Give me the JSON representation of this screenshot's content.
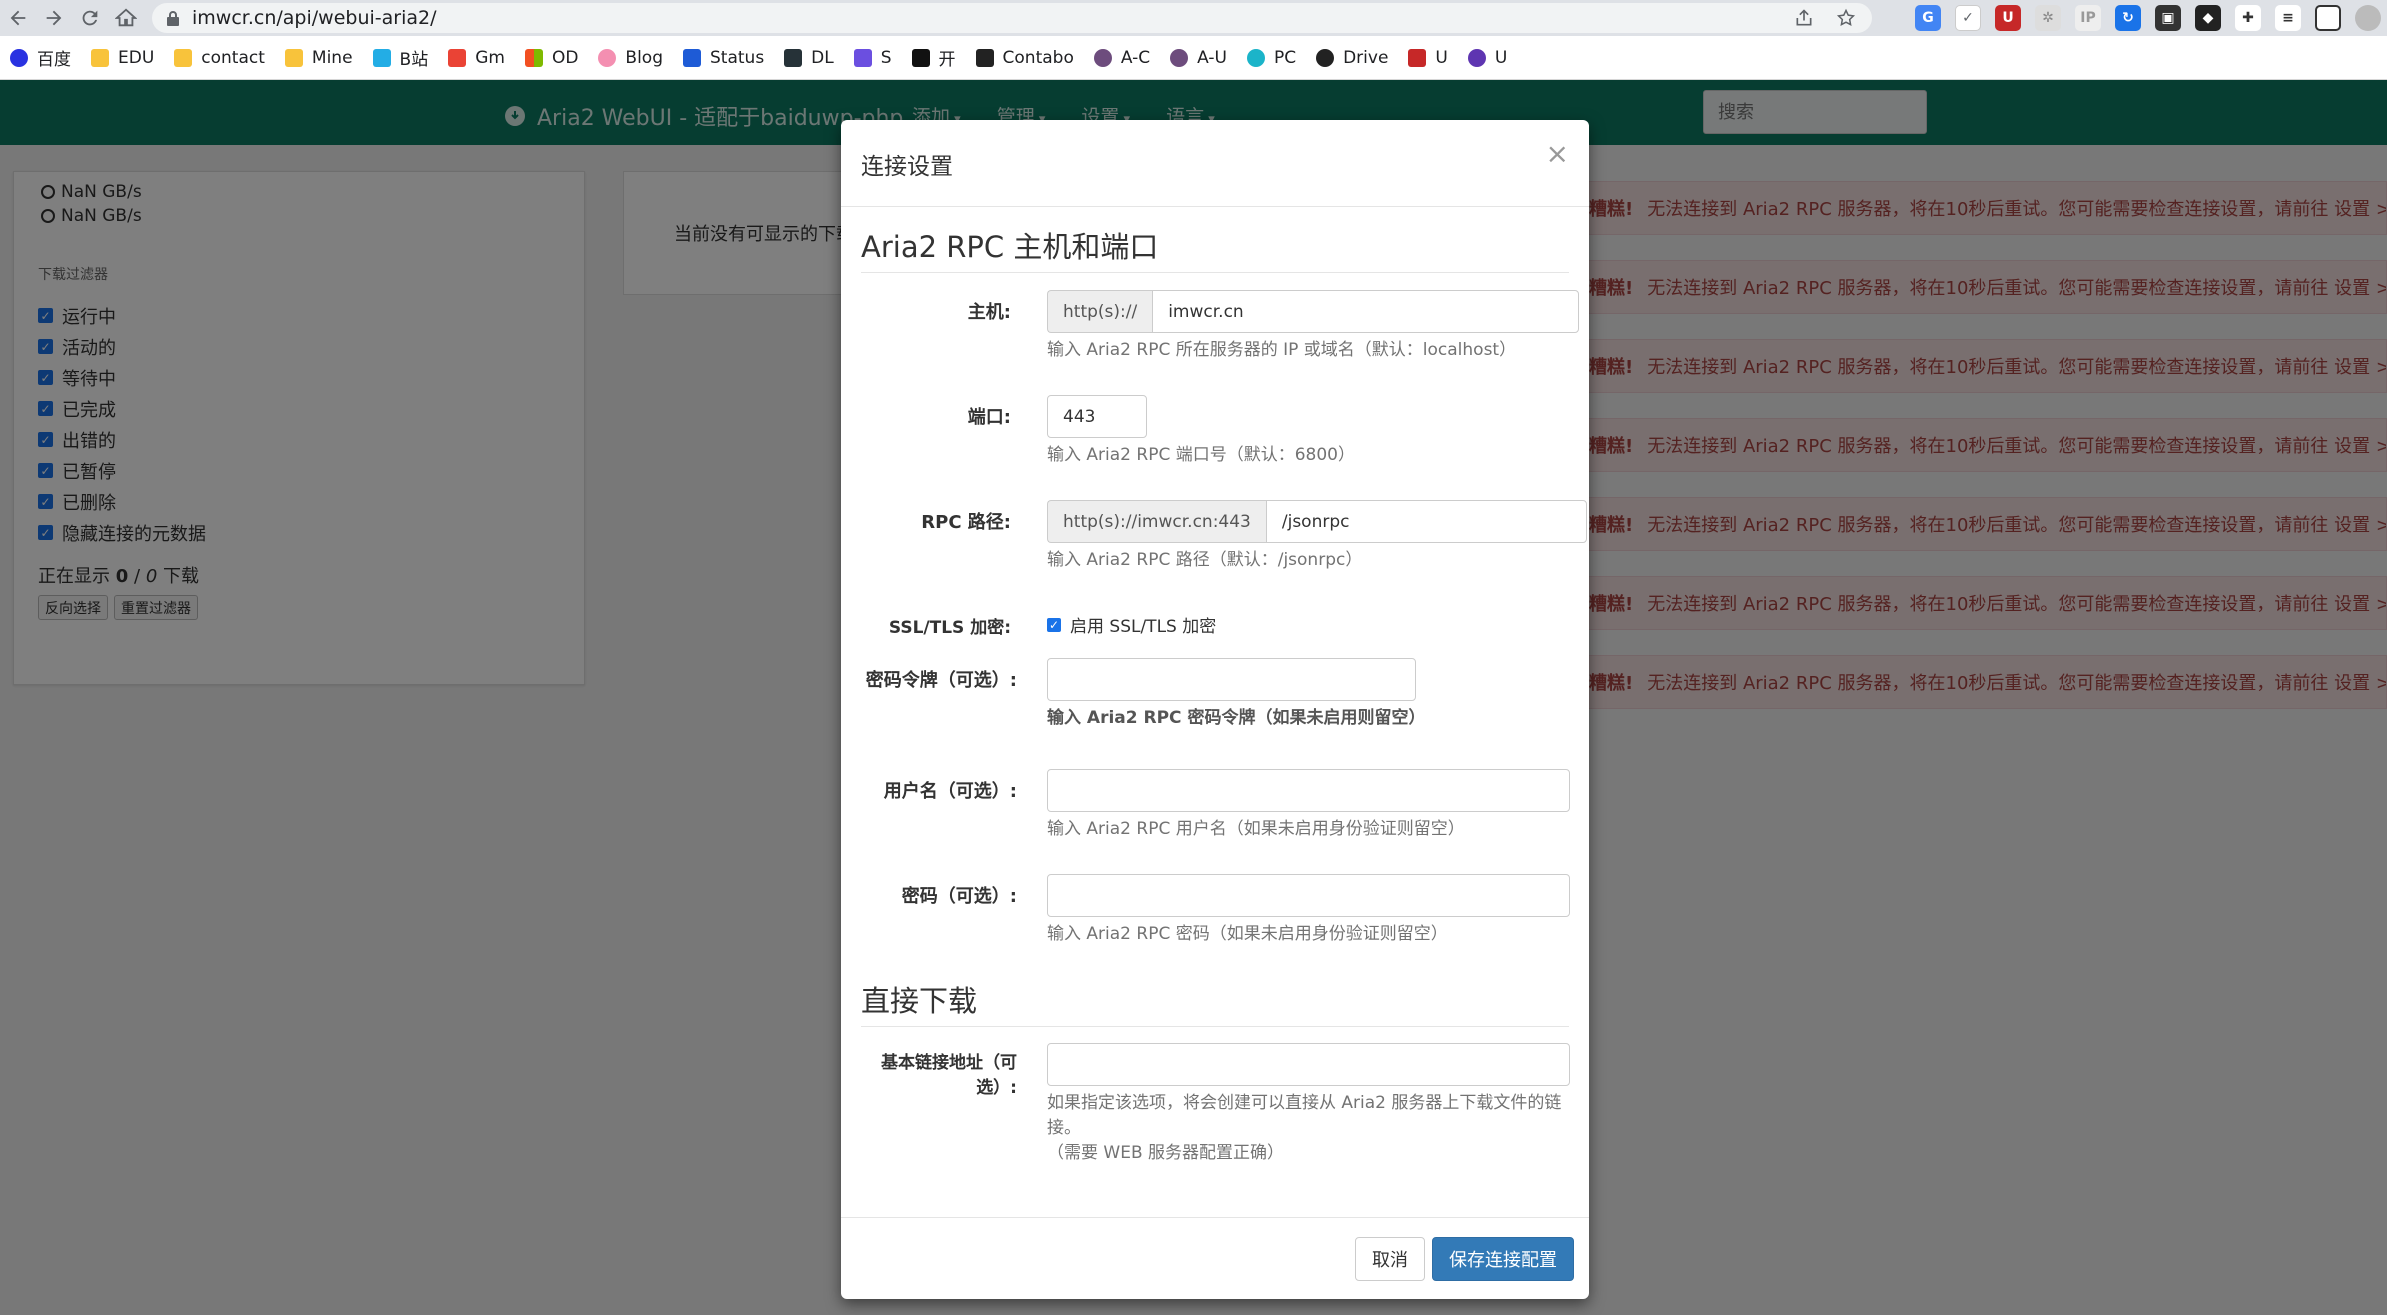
{
  "browser": {
    "url": "imwcr.cn/api/webui-aria2/",
    "bookmarks": [
      "百度",
      "EDU",
      "contact",
      "Mine",
      "B站",
      "Gm",
      "OD",
      "Blog",
      "Status",
      "DL",
      "S",
      "开",
      "Contabo",
      "A-C",
      "A-U",
      "PC",
      "Drive",
      "U",
      "U"
    ]
  },
  "navbar": {
    "brand": "Aria2 WebUI - 适配于baiduwp-php",
    "menus": [
      "添加",
      "管理",
      "设置",
      "语言"
    ],
    "search_placeholder": "搜索",
    "color": "#0d7a63"
  },
  "sidebar": {
    "download_speed": "NaN GB/s",
    "upload_speed": "NaN GB/s",
    "filter_title": "下载过滤器",
    "filters": [
      "运行中",
      "活动的",
      "等待中",
      "已完成",
      "出错的",
      "已暂停",
      "已删除",
      "隐藏连接的元数据"
    ],
    "showing_prefix": "正在显示",
    "showing_count": "0",
    "showing_sep": "/",
    "showing_total": "0",
    "showing_suffix": "下载",
    "btn_invert": "反向选择",
    "btn_reset": "重置过滤器"
  },
  "content": {
    "empty_text": "当前没有可显示的下载"
  },
  "alerts": {
    "title": "糟糕!",
    "message": "无法连接到 Aria2 RPC 服务器，将在10秒后重试。您可能需要检查连接设置，请前往 设置 > 连接设置",
    "count": 7
  },
  "modal": {
    "title": "连接设置",
    "close": "×",
    "section_rpc": "Aria2 RPC 主机和端口",
    "host_label": "主机:",
    "host_addon": "http(s)://",
    "host_value": "imwcr.cn",
    "host_help": "输入 Aria2 RPC 所在服务器的 IP 或域名（默认：localhost）",
    "port_label": "端口:",
    "port_value": "443",
    "port_help": "输入 Aria2 RPC 端口号（默认：6800）",
    "path_label": "RPC 路径:",
    "path_addon": "http(s)://imwcr.cn:443",
    "path_value": "/jsonrpc",
    "path_help": "输入 Aria2 RPC 路径（默认：/jsonrpc）",
    "ssl_label": "SSL/TLS 加密:",
    "ssl_text": "启用 SSL/TLS 加密",
    "ssl_checked": true,
    "token_label": "密码令牌（可选）:",
    "token_value": "",
    "token_help": "输入 Aria2 RPC 密码令牌（如果未启用则留空）",
    "username_label": "用户名（可选）:",
    "username_value": "",
    "username_help": "输入 Aria2 RPC 用户名（如果未启用身份验证则留空）",
    "password_label": "密码（可选）:",
    "password_value": "",
    "password_help": "输入 Aria2 RPC 密码（如果未启用身份验证则留空）",
    "section_direct": "直接下载",
    "base_url_label": "基本链接地址（可选）:",
    "base_url_value": "",
    "base_url_help": "如果指定该选项，将会创建可以直接从 Aria2 服务器上下载文件的链接。",
    "base_url_help2": "（需要 WEB 服务器配置正确）",
    "btn_cancel": "取消",
    "btn_save": "保存连接配置",
    "primary_color": "#337ab7"
  }
}
